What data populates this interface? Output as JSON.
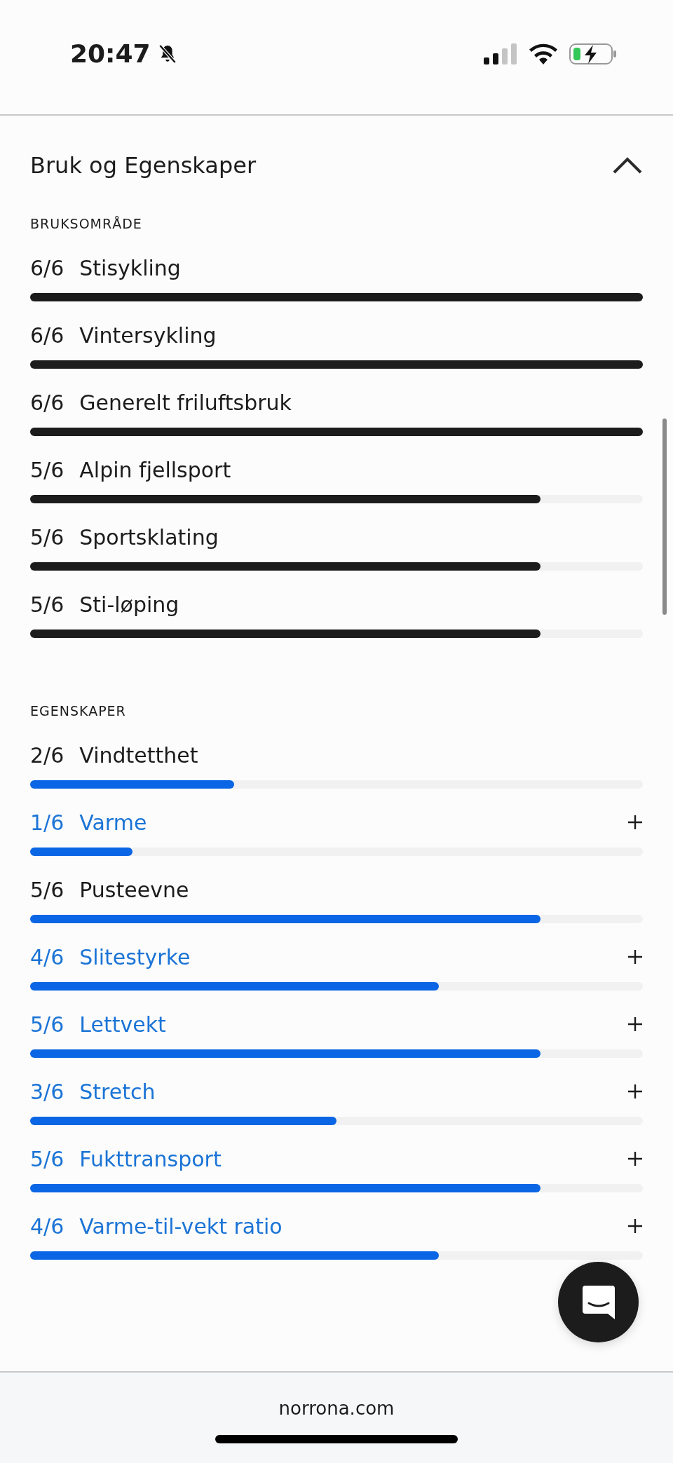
{
  "status_bar": {
    "time": "20:47"
  },
  "panel": {
    "title": "Bruk og Egenskaper",
    "expanded": true
  },
  "sections": [
    {
      "heading": "BRUKSOMRÅDE",
      "color": "#1c1c1c",
      "rows": [
        {
          "score": "6/6",
          "label": "Stisykling",
          "level": 1,
          "expandable": false
        },
        {
          "score": "6/6",
          "label": "Vintersykling",
          "level": 1,
          "expandable": false
        },
        {
          "score": "6/6",
          "label": "Generelt friluftsbruk",
          "level": 1,
          "expandable": false
        },
        {
          "score": "5/6",
          "label": "Alpin fjellsport",
          "level": 0.833,
          "expandable": false
        },
        {
          "score": "5/6",
          "label": "Sportsklating",
          "level": 0.833,
          "expandable": false
        },
        {
          "score": "5/6",
          "label": "Sti-løping",
          "level": 0.833,
          "expandable": false
        }
      ]
    },
    {
      "heading": "EGENSKAPER",
      "color": "#0a66e4",
      "rows": [
        {
          "score": "2/6",
          "label": "Vindtetthet",
          "level": 0.333,
          "expandable": false
        },
        {
          "score": "1/6",
          "label": "Varme",
          "level": 0.167,
          "expandable": true
        },
        {
          "score": "5/6",
          "label": "Pusteevne",
          "level": 0.833,
          "expandable": false
        },
        {
          "score": "4/6",
          "label": "Slitestyrke",
          "level": 0.667,
          "expandable": true
        },
        {
          "score": "5/6",
          "label": "Lettvekt",
          "level": 0.833,
          "expandable": true
        },
        {
          "score": "3/6",
          "label": "Stretch",
          "level": 0.5,
          "expandable": true
        },
        {
          "score": "5/6",
          "label": "Fukttransport",
          "level": 0.833,
          "expandable": true
        },
        {
          "score": "4/6",
          "label": "Varme-til-vekt ratio",
          "level": 0.667,
          "expandable": true
        }
      ]
    }
  ],
  "browser": {
    "url": "norrona.com"
  }
}
